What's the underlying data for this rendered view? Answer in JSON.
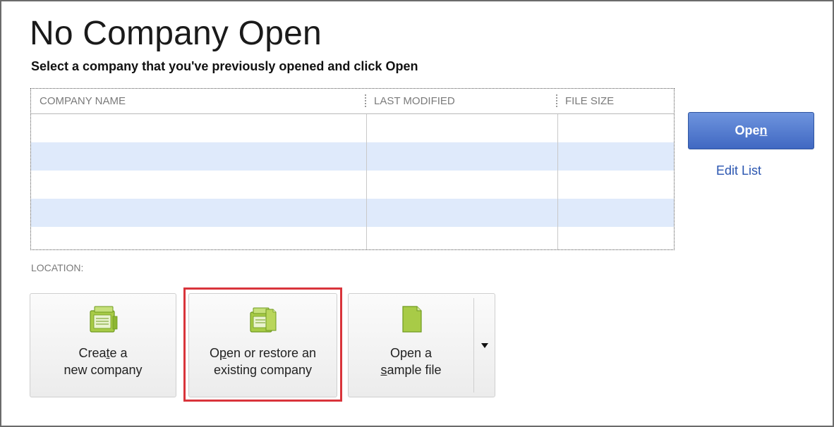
{
  "title": "No Company Open",
  "subtitle": "Select a company that you've previously opened and click Open",
  "table": {
    "columns": [
      "COMPANY NAME",
      "LAST MODIFIED",
      "FILE SIZE"
    ],
    "rows": [
      [
        "",
        "",
        ""
      ],
      [
        "",
        "",
        ""
      ],
      [
        "",
        "",
        ""
      ],
      [
        "",
        "",
        ""
      ],
      [
        "",
        "",
        ""
      ]
    ]
  },
  "buttons": {
    "open_pre": "Ope",
    "open_mnemonic": "n",
    "edit_list": "Edit List"
  },
  "location_label": "LOCATION:",
  "tiles": {
    "create": {
      "line1_pre": "Crea",
      "line1_mnemonic": "t",
      "line1_post": "e a",
      "line2": "new company",
      "icon": "new-company-icon"
    },
    "open_restore": {
      "line1_pre": "O",
      "line1_mnemonic": "p",
      "line1_post": "en or restore an",
      "line2": "existing company",
      "icon": "open-company-icon"
    },
    "sample": {
      "line1": "Open a",
      "line2_mnemonic": "s",
      "line2_post": "ample file",
      "icon": "sample-file-icon"
    }
  },
  "colors": {
    "accent_blue": "#4068c2",
    "row_alt": "#dfeafb",
    "highlight_red": "#d9343b",
    "icon_green": "#9cc23a"
  }
}
